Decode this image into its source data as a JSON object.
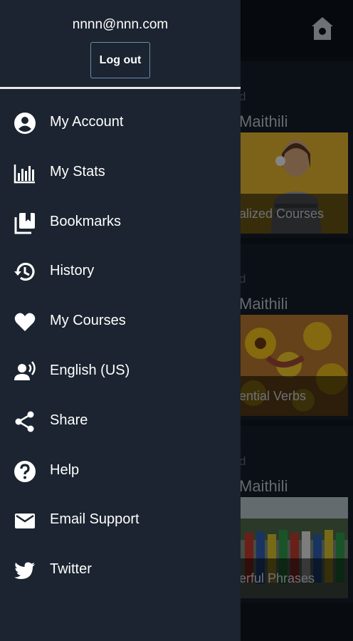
{
  "drawer": {
    "email": "nnnn@nnn.com",
    "logout_label": "Log out",
    "items": [
      {
        "label": "My Account",
        "icon": "account-circle-icon"
      },
      {
        "label": "My Stats",
        "icon": "bar-chart-icon"
      },
      {
        "label": "Bookmarks",
        "icon": "bookmarks-icon"
      },
      {
        "label": "History",
        "icon": "history-icon"
      },
      {
        "label": "My Courses",
        "icon": "heart-icon"
      },
      {
        "label": "English (US)",
        "icon": "voice-icon"
      },
      {
        "label": "Share",
        "icon": "share-icon"
      },
      {
        "label": "Help",
        "icon": "help-icon"
      },
      {
        "label": "Email Support",
        "icon": "email-icon"
      },
      {
        "label": "Twitter",
        "icon": "twitter-icon"
      }
    ]
  },
  "background": {
    "cards": [
      {
        "kicker": "d",
        "language": "Maithili",
        "caption": "alized Courses"
      },
      {
        "kicker": "d",
        "language": "Maithili",
        "caption": "ential Verbs"
      },
      {
        "kicker": "d",
        "language": "Maithili",
        "caption": "erful Phrases"
      }
    ]
  },
  "colors": {
    "drawer_bg": "#1b2430",
    "app_bg": "#0f161f",
    "text": "#ffffff",
    "logout_border": "#6d8bb0"
  }
}
